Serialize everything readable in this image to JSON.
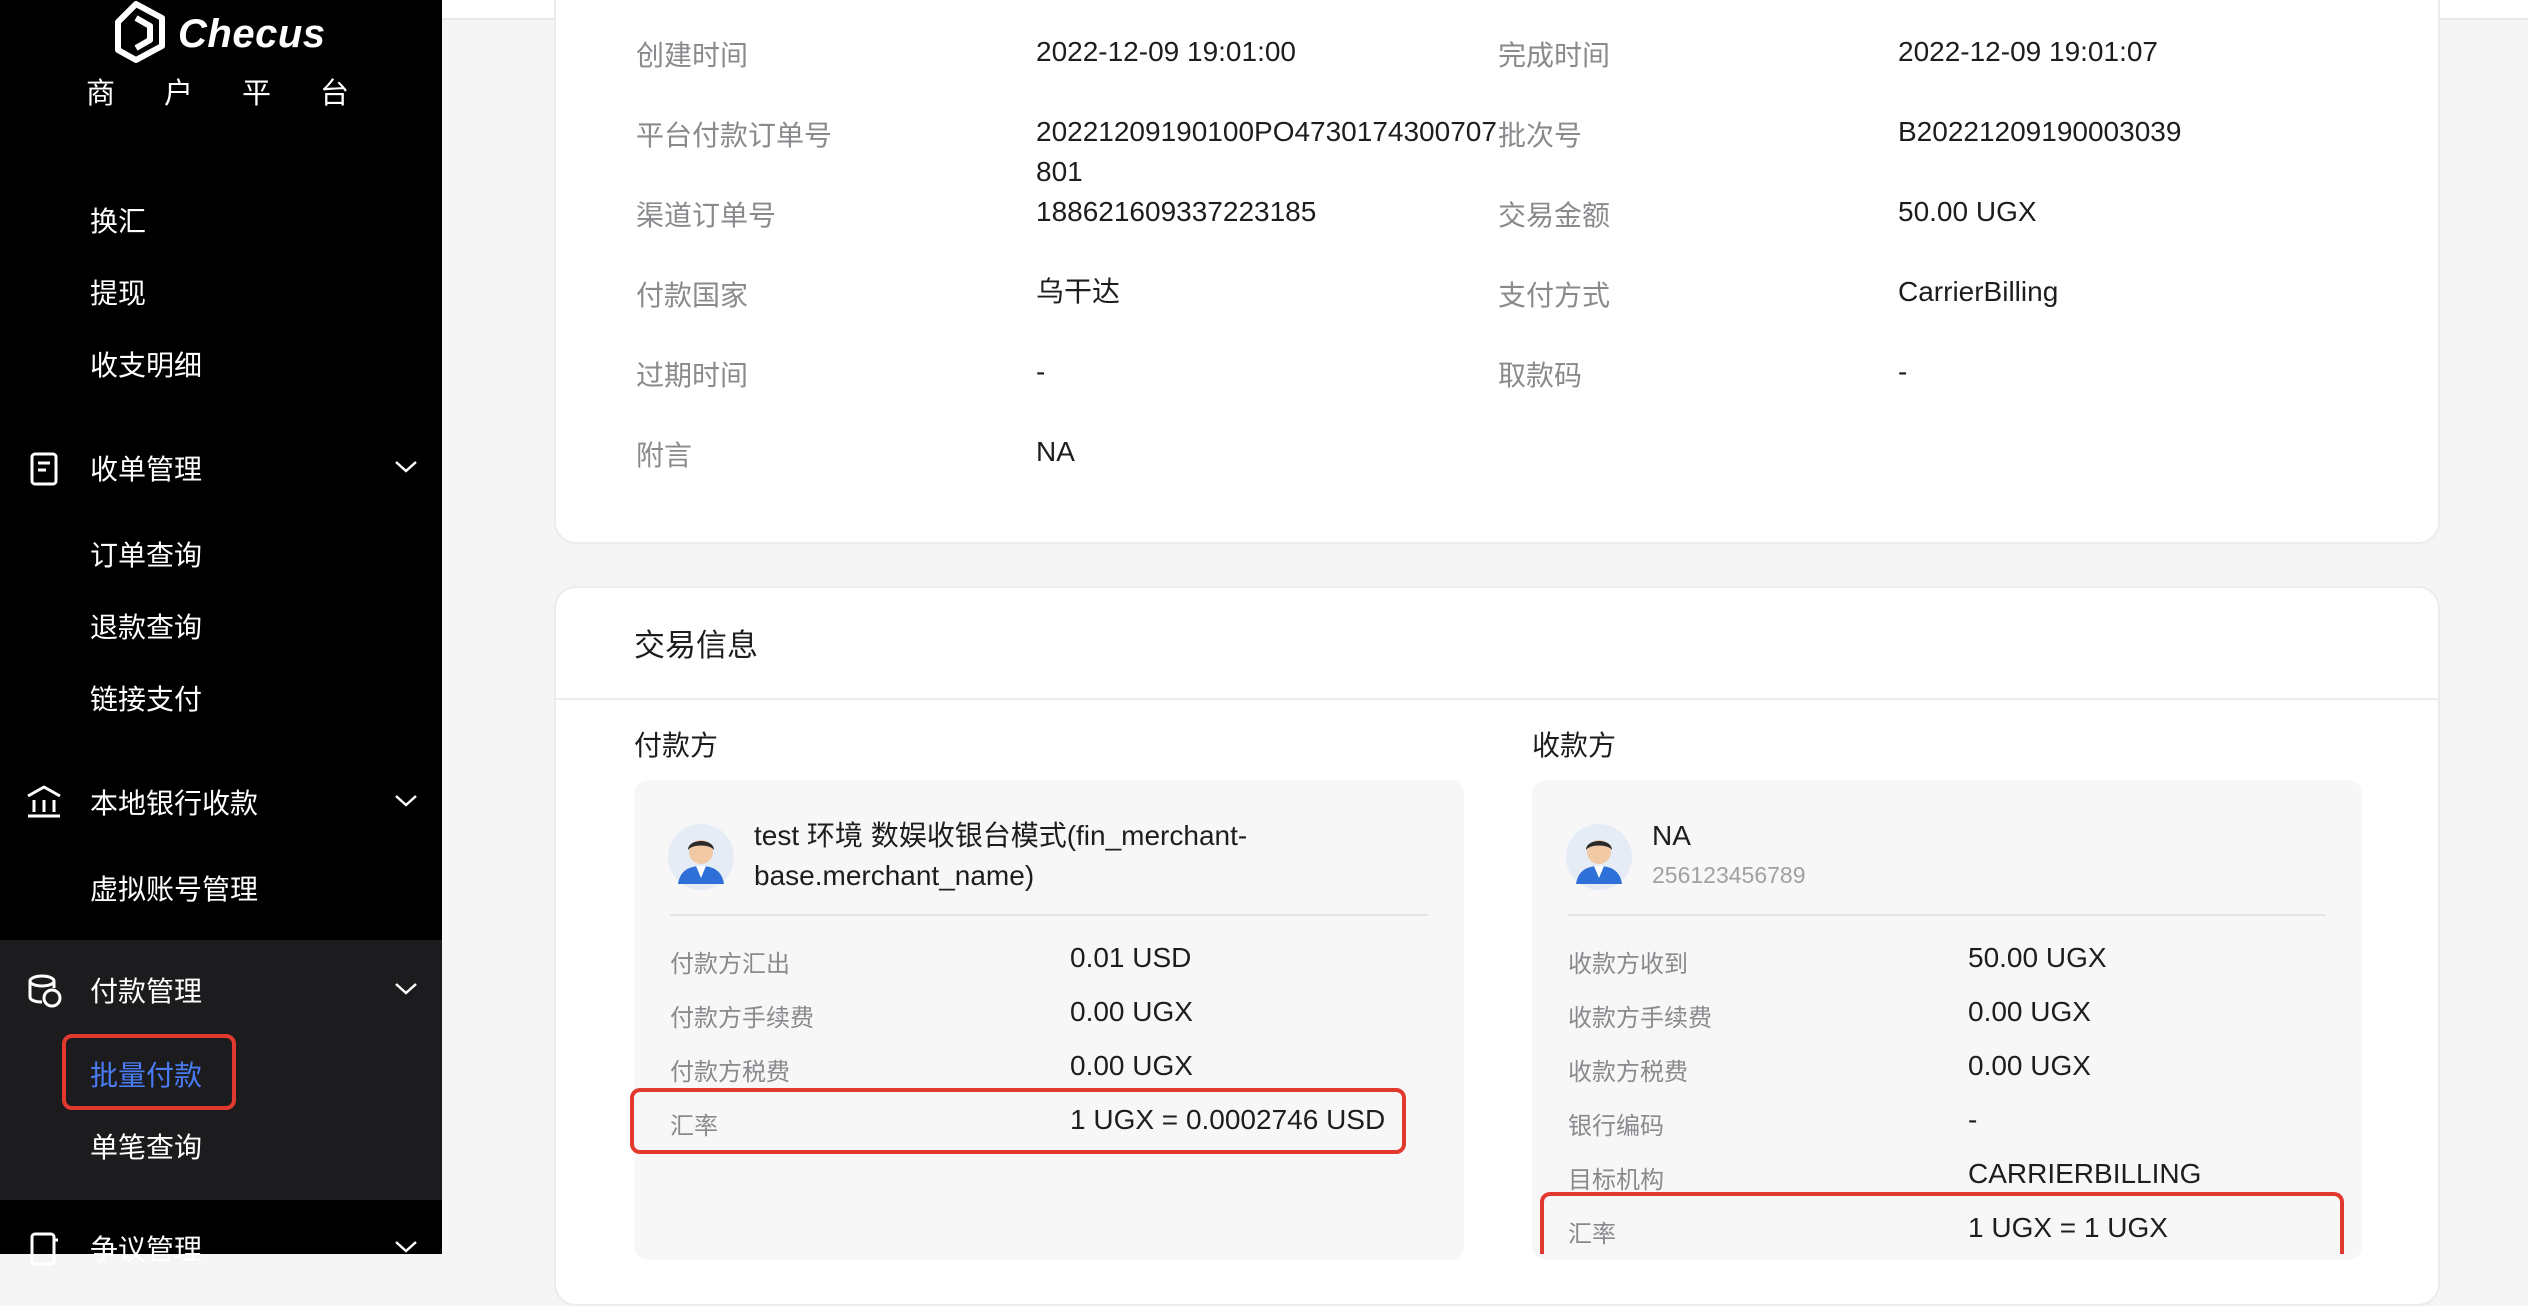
{
  "brand": {
    "name": "Checus",
    "subtitle": "商户平台"
  },
  "sidebar": {
    "top_items": [
      "换汇",
      "提现",
      "收支明细"
    ],
    "groups": [
      {
        "label": "收单管理",
        "icon": "receipt-icon",
        "items": [
          "订单查询",
          "退款查询",
          "链接支付"
        ]
      },
      {
        "label": "本地银行收款",
        "icon": "bank-icon",
        "items": [
          "虚拟账号管理"
        ]
      },
      {
        "label": "付款管理",
        "icon": "coins-icon",
        "items": [
          "批量付款",
          "单笔查询"
        ],
        "active_item": "批量付款"
      },
      {
        "label": "争议管理",
        "icon": "dispute-icon",
        "items": []
      }
    ],
    "active_color": "#4a7cf6"
  },
  "order_info": {
    "rows": [
      {
        "label_left": "创建时间",
        "value_left": "2022-12-09 19:01:00",
        "label_right": "完成时间",
        "value_right": "2022-12-09 19:01:07"
      },
      {
        "label_left": "平台付款订单号",
        "value_left": "20221209190100PO4730174300707801",
        "label_right": "批次号",
        "value_right": "B20221209190003039"
      },
      {
        "label_left": "渠道订单号",
        "value_left": "188621609337223185",
        "label_right": "交易金额",
        "value_right": "50.00 UGX"
      },
      {
        "label_left": "付款国家",
        "value_left": "乌干达",
        "label_right": "支付方式",
        "value_right": "CarrierBilling"
      },
      {
        "label_left": "过期时间",
        "value_left": "-",
        "label_right": "取款码",
        "value_right": "-"
      },
      {
        "label_left": "附言",
        "value_left": "NA"
      }
    ]
  },
  "transaction": {
    "title": "交易信息",
    "payer": {
      "title": "付款方",
      "name": "test 环境 数娱收银台模式(fin_merchant-base.merchant_name)",
      "rows": [
        {
          "label": "付款方汇出",
          "value": "0.01 USD"
        },
        {
          "label": "付款方手续费",
          "value": "0.00 UGX"
        },
        {
          "label": "付款方税费",
          "value": "0.00 UGX"
        },
        {
          "label": "汇率",
          "value": "1 UGX = 0.0002746 USD",
          "highlighted": true
        }
      ]
    },
    "payee": {
      "title": "收款方",
      "name": "NA",
      "phone": "256123456789",
      "rows": [
        {
          "label": "收款方收到",
          "value": "50.00 UGX"
        },
        {
          "label": "收款方手续费",
          "value": "0.00 UGX"
        },
        {
          "label": "收款方税费",
          "value": "0.00 UGX"
        },
        {
          "label": "银行编码",
          "value": "-"
        },
        {
          "label": "目标机构",
          "value": "CARRIERBILLING"
        },
        {
          "label": "汇率",
          "value": "1 UGX = 1 UGX",
          "highlighted": true
        }
      ]
    }
  },
  "highlight_color": "#e2392f"
}
